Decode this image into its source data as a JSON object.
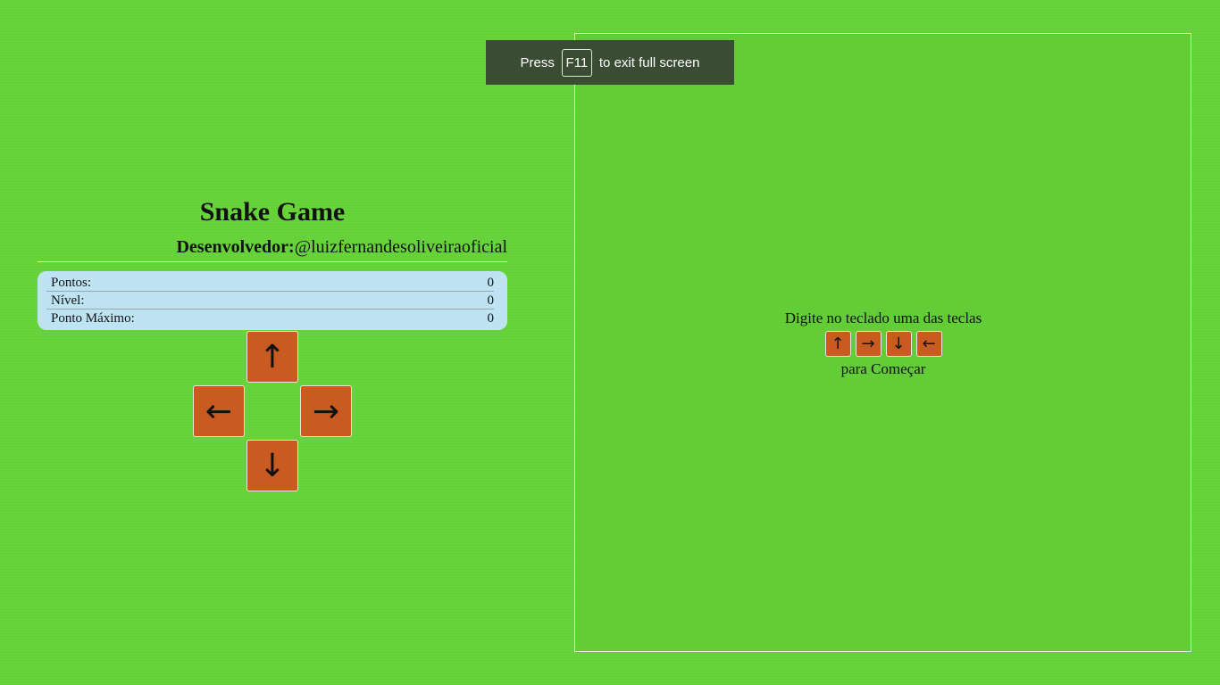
{
  "fullscreen_notice": {
    "press": "Press",
    "key": "F11",
    "suffix": "to exit full screen"
  },
  "header": {
    "title": "Snake Game",
    "developer_label": "Desenvolvedor:",
    "developer_handle": "@luizfernandesoliveiraoficial"
  },
  "stats": [
    {
      "label": "Pontos:",
      "value": "0"
    },
    {
      "label": "Nível:",
      "value": "0"
    },
    {
      "label": "Ponto Máximo:",
      "value": "0"
    }
  ],
  "controls": {
    "up": "↑",
    "left": "←",
    "right": "→",
    "down": "↓"
  },
  "board": {
    "start_line1": "Digite no teclado uma das teclas",
    "keys": [
      "↑",
      "→",
      "↓",
      "←"
    ],
    "start_line2": "para Começar"
  },
  "colors": {
    "background": "#66d439",
    "button": "#c95a20",
    "stats_panel": "#bee4f3",
    "notice": "#3a4d34"
  },
  "icons": {
    "up": "arrow-up-icon",
    "left": "arrow-left-icon",
    "right": "arrow-right-icon",
    "down": "arrow-down-icon"
  }
}
